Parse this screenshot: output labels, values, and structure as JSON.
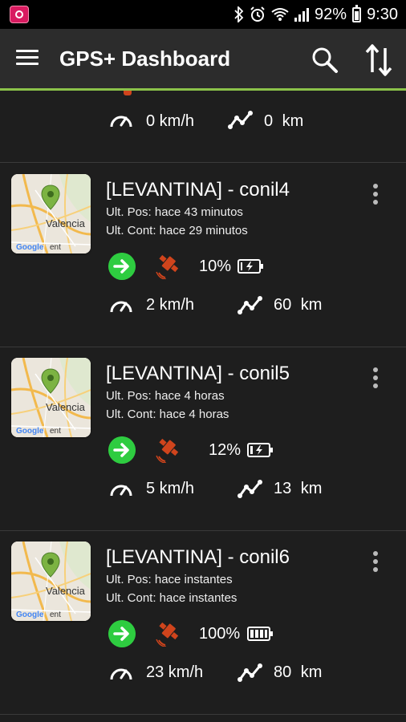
{
  "status_bar": {
    "icons": [
      "bluetooth-icon",
      "alarm-icon",
      "wifi-icon",
      "signal-icon"
    ],
    "battery_percent": "92%",
    "time": "9:30"
  },
  "toolbar": {
    "title": "GPS+ Dashboard",
    "menu_icon": "menu-icon",
    "search_icon": "search-icon",
    "sort_icon": "sort-icon"
  },
  "colors": {
    "accent": "#8bc34a",
    "go_green": "#2ecc40",
    "satellite": "#d0441c"
  },
  "partial_device": {
    "speed": "0 km/h",
    "distance": "0  km"
  },
  "devices": [
    {
      "name": "[LEVANTINA] - conil4",
      "last_position": "Ult. Pos: hace 43 minutos",
      "last_contact": "Ult. Cont: hace 29 minutos",
      "battery_percent": "10%",
      "battery_level": 0.1,
      "speed": "2 km/h",
      "distance": "60  km",
      "map_labels": [
        "Valencia",
        "Google",
        "ent"
      ]
    },
    {
      "name": "[LEVANTINA] - conil5",
      "last_position": "Ult. Pos: hace 4 horas",
      "last_contact": "Ult. Cont: hace 4 horas",
      "battery_percent": "12%",
      "battery_level": 0.12,
      "speed": "5 km/h",
      "distance": "13  km",
      "map_labels": [
        "Valencia",
        "Google",
        "ent"
      ]
    },
    {
      "name": "[LEVANTINA] - conil6",
      "last_position": "Ult. Pos: hace instantes",
      "last_contact": "Ult. Cont: hace instantes",
      "battery_percent": "100%",
      "battery_level": 1.0,
      "speed": "23 km/h",
      "distance": "80  km",
      "map_labels": [
        "Valencia",
        "Google",
        "ent"
      ]
    }
  ]
}
